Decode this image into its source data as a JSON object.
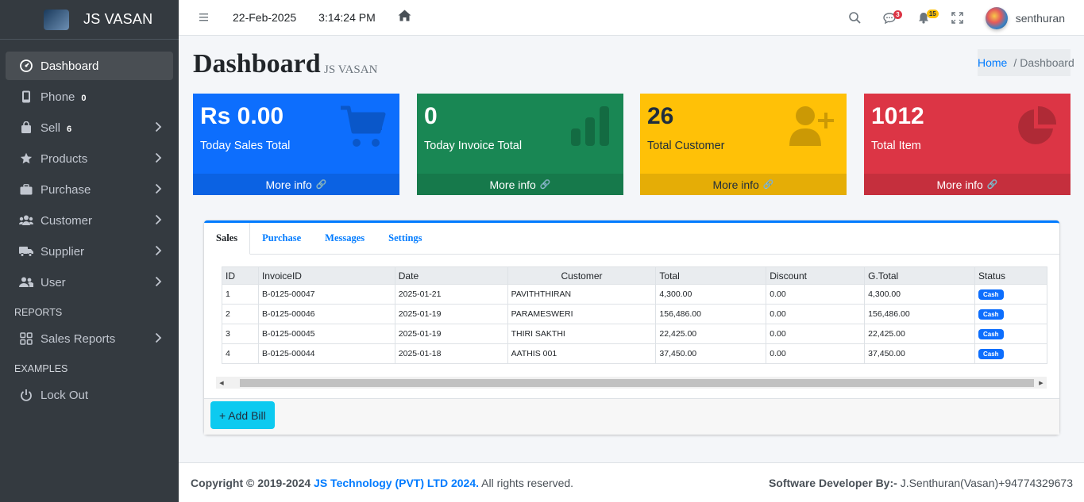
{
  "brand": {
    "name": "JS VASAN"
  },
  "sidebar": {
    "items": [
      {
        "label": "Dashboard",
        "icon": "dashboard-icon",
        "badge": "",
        "active": true
      },
      {
        "label": "Phone",
        "icon": "phone-icon",
        "badge": "0"
      },
      {
        "label": "Sell",
        "icon": "bag-icon",
        "badge": "6"
      },
      {
        "label": "Products",
        "icon": "star-icon",
        "badge": ""
      },
      {
        "label": "Purchase",
        "icon": "briefcase-icon",
        "badge": ""
      },
      {
        "label": "Customer",
        "icon": "users-icon",
        "badge": ""
      },
      {
        "label": "Supplier",
        "icon": "truck-icon",
        "badge": ""
      },
      {
        "label": "User",
        "icon": "user-group-icon",
        "badge": ""
      }
    ],
    "reports_header": "REPORTS",
    "sales_reports": "Sales Reports",
    "examples_header": "EXAMPLES",
    "lock_out": "Lock Out"
  },
  "topbar": {
    "date": "22-Feb-2025",
    "time": "3:14:24 PM",
    "messages_count": "3",
    "notifications_count": "15",
    "username": "senthuran"
  },
  "header": {
    "title": "Dashboard",
    "subtitle": "JS VASAN",
    "breadcrumb_home": "Home",
    "breadcrumb_sep": "/",
    "breadcrumb_current": "Dashboard"
  },
  "boxes": [
    {
      "value": "Rs 0.00",
      "label": "Today Sales Total",
      "more": "More info",
      "color": "#0d6efd"
    },
    {
      "value": "0",
      "label": "Today Invoice Total",
      "more": "More info",
      "color": "#198754"
    },
    {
      "value": "26",
      "label": "Total Customer",
      "more": "More info",
      "color": "#ffc107"
    },
    {
      "value": "1012",
      "label": "Total Item",
      "more": "More info",
      "color": "#dc3545"
    }
  ],
  "tabs": [
    "Sales",
    "Purchase",
    "Messages",
    "Settings"
  ],
  "table": {
    "headers": [
      "ID",
      "InvoiceID",
      "Date",
      "Customer",
      "Total",
      "Discount",
      "G.Total",
      "Status"
    ],
    "rows": [
      [
        "1",
        "B-0125-00047",
        "2025-01-21",
        "PAVITHTHIRAN",
        "4,300.00",
        "0.00",
        "4,300.00",
        "Cash"
      ],
      [
        "2",
        "B-0125-00046",
        "2025-01-19",
        "PARAMESWERI",
        "156,486.00",
        "0.00",
        "156,486.00",
        "Cash"
      ],
      [
        "3",
        "B-0125-00045",
        "2025-01-19",
        "THIRI SAKTHI",
        "22,425.00",
        "0.00",
        "22,425.00",
        "Cash"
      ],
      [
        "4",
        "B-0125-00044",
        "2025-01-18",
        "AATHIS 001",
        "37,450.00",
        "0.00",
        "37,450.00",
        "Cash"
      ]
    ]
  },
  "add_bill": "+ Add Bill",
  "footer": {
    "copyright": "Copyright © 2019-2024",
    "company": "JS Technology (PVT) LTD 2024.",
    "rights": "All rights reserved.",
    "dev_label": "Software Developer By:-",
    "dev_name": "J.Senthuran(Vasan)+94774329673"
  }
}
